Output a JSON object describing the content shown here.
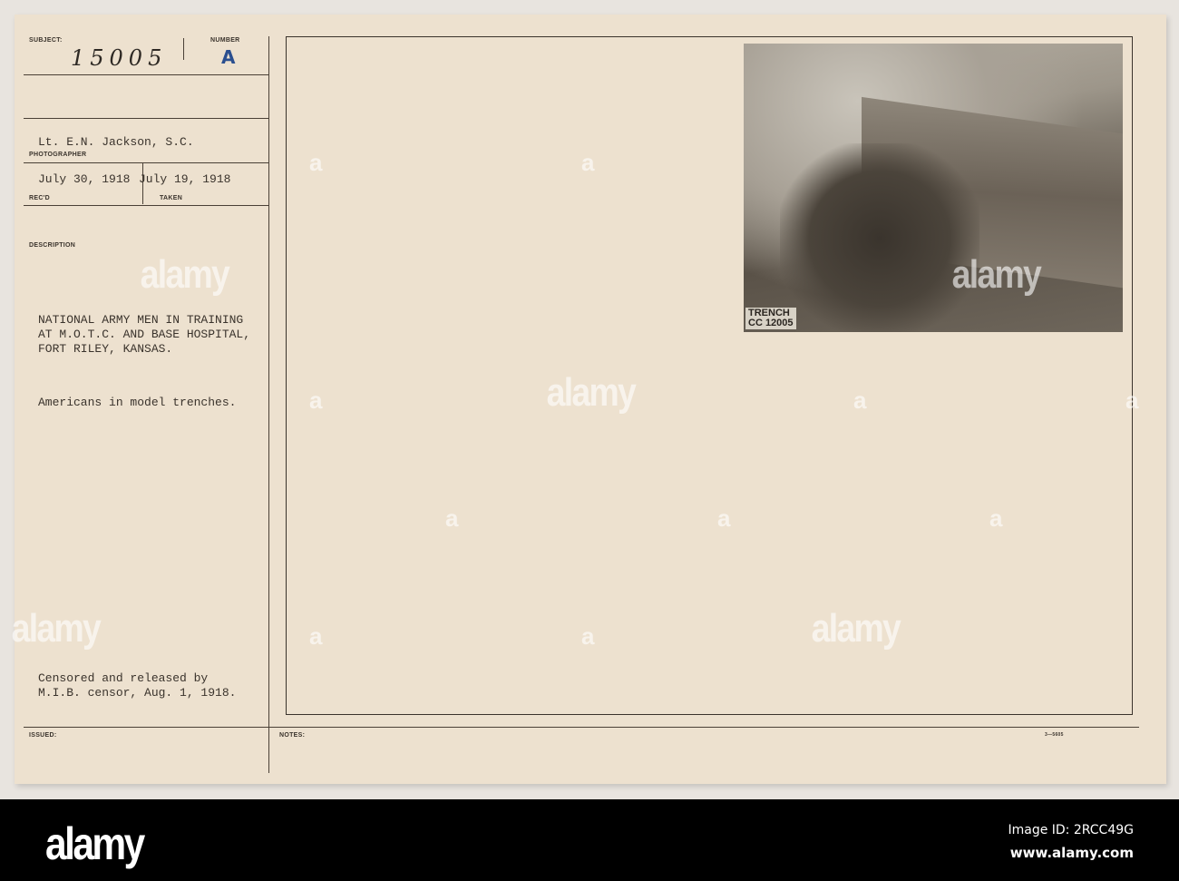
{
  "card": {
    "subject_label": "SUBJECT:",
    "subject_value": "15005",
    "number_label": "NUMBER",
    "number_value": "A",
    "photographer_value": "Lt. E.N. Jackson, S.C.",
    "photographer_label": "PHOTOGRAPHER",
    "received_value": "July 30, 1918",
    "received_label": "REC'D",
    "taken_value": "July 19, 1918",
    "taken_label": "TAKEN",
    "description_label": "DESCRIPTION",
    "description_lines": [
      "NATIONAL ARMY MEN IN TRAINING",
      "AT M.O.T.C. AND BASE HOSPITAL,",
      "FORT RILEY, KANSAS."
    ],
    "caption": "Americans in model trenches.",
    "censor_lines": [
      "Censored and released by",
      "M.I.B. censor, Aug. 1, 1918."
    ],
    "issued_label": "ISSUED:",
    "notes_label": "NOTES:",
    "form_number": "3—5605"
  },
  "photo": {
    "caption_line1": "TRENCH",
    "caption_line2": "CC 12005"
  },
  "watermark": {
    "text": "alamy",
    "letter": "a"
  },
  "footer": {
    "logo": "alamy",
    "image_id": "Image ID: 2RCC49G",
    "url": "www.alamy.com"
  },
  "colors": {
    "paper": "#ede1cf",
    "stamp_blue": "#2b4f8f"
  }
}
